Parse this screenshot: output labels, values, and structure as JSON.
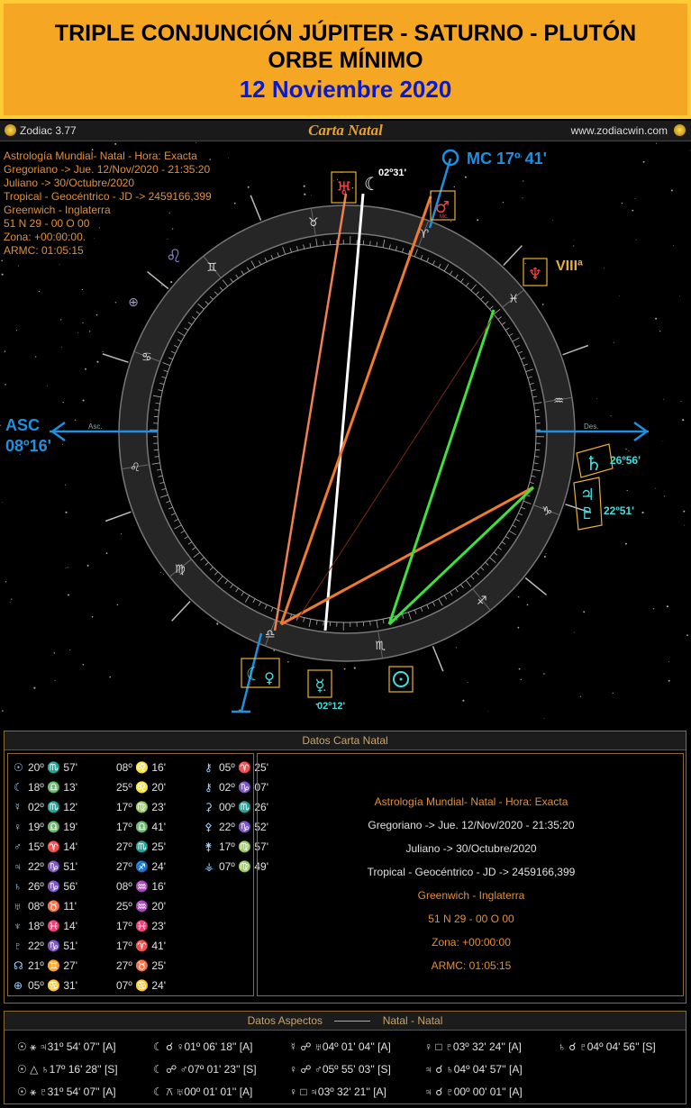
{
  "banner": {
    "line1": "TRIPLE CONJUNCIÓN JÚPITER - SATURNO - PLUTÓN",
    "line2": "ORBE MÍNIMO",
    "line3": "12 Noviembre 2020"
  },
  "window": {
    "app_name": "Zodiac 3.77",
    "title": "Carta Natal",
    "url": "www.zodiacwin.com"
  },
  "chart_info": [
    "Astrología Mundial- Natal - Hora: Exacta",
    "Gregoriano -> Jue. 12/Nov/2020 - 21:35:20",
    "Juliano -> 30/Octubre/2020",
    "Tropical - Geocéntrico - JD -> 2459166,399",
    "Greenwich - Inglaterra",
    "51 N 29 - 00 O 00",
    "Zona: +00:00:00.",
    "ARMC: 01:05:15"
  ],
  "wheel_labels": {
    "mc": "MC 17º 41'",
    "asc_1": "ASC",
    "asc_2": "08º16'",
    "asc_small": "Asc.",
    "des_small": "Des.",
    "house8": "VIIIª",
    "mc_small": "Mc.",
    "moon_deg": "02º31'",
    "saturn_deg": "26º56'",
    "jup_plu_deg": "22º51'",
    "mercury_deg": "02º12'"
  },
  "colors": {
    "banner_bg": "#f5a623",
    "banner_blue": "#0a1ac8",
    "ring": "#2b2b2b",
    "asc_mc": "#1e90e0",
    "orange": "#f07a30",
    "green": "#3ee03e",
    "highlight": "#e8b030"
  },
  "datos_carta": {
    "header": "Datos Carta Natal",
    "rows": [
      {
        "g1": "☉",
        "p1": "20º ♏ 57'",
        "g2": "",
        "p2": "08º ♌ 16'",
        "g3": "⚷",
        "p3": "05º ♈ 25'"
      },
      {
        "g1": "☾",
        "p1": "18º ♎ 13'",
        "g2": "",
        "p2": "25º ♌ 20'",
        "g3": "⚷",
        "p3": "02º ♑ 07'"
      },
      {
        "g1": "☿",
        "p1": "02º ♏ 12'",
        "g2": "",
        "p2": "17º ♍ 23'",
        "g3": "⚳",
        "p3": "00º ♏ 26'"
      },
      {
        "g1": "♀",
        "p1": "19º ♎ 19'",
        "g2": "",
        "p2": "17º ♎ 41'",
        "g3": "⚴",
        "p3": "22º ♑ 52'"
      },
      {
        "g1": "♂",
        "p1": "15º ♈ 14'",
        "g2": "",
        "p2": "27º ♏ 25'",
        "g3": "⚵",
        "p3": "17º ♍ 57'"
      },
      {
        "g1": "♃",
        "p1": "22º ♑ 51'",
        "g2": "",
        "p2": "27º ♐ 24'",
        "g3": "⚶",
        "p3": "07º ♍ 49'"
      },
      {
        "g1": "♄",
        "p1": "26º ♑ 56'",
        "g2": "",
        "p2": "08º ♒ 16'",
        "g3": "",
        "p3": ""
      },
      {
        "g1": "♅",
        "p1": "08º ♉ 11'",
        "g2": "",
        "p2": "25º ♒ 20'",
        "g3": "",
        "p3": ""
      },
      {
        "g1": "♆",
        "p1": "18º ♓ 14'",
        "g2": "",
        "p2": "17º ♓ 23'",
        "g3": "",
        "p3": ""
      },
      {
        "g1": "♇",
        "p1": "22º ♑ 51'",
        "g2": "",
        "p2": "17º ♈ 41'",
        "g3": "",
        "p3": ""
      },
      {
        "g1": "☊",
        "p1": "21º ♊ 27'",
        "g2": "",
        "p2": "27º ♉ 25'",
        "g3": "",
        "p3": ""
      },
      {
        "g1": "⊕",
        "p1": "05º ♋ 31'",
        "g2": "",
        "p2": "07º ♋ 24'",
        "g3": "",
        "p3": ""
      }
    ],
    "summary": [
      "Astrología Mundial- Natal - Hora: Exacta",
      "Gregoriano -> Jue. 12/Nov/2020 - 21:35:20",
      "Juliano -> 30/Octubre/2020",
      "Tropical - Geocéntrico - JD -> 2459166,399",
      "Greenwich - Inglaterra",
      "51 N 29 - 00 O 00",
      "Zona: +00:00:00",
      "ARMC: 01:05:15"
    ]
  },
  "datos_aspectos": {
    "header_left": "Datos Aspectos",
    "header_right": "Natal - Natal",
    "rows": [
      [
        "☉ ⚹ ♃31º 54' 07'' [A]",
        "☾ ☌ ♀01º 06' 18'' [A]",
        "☿ ☍ ♅04º 01' 04'' [A]",
        "♀ □ ♇03º 32' 24'' [A]",
        "♄ ☌ ♇04º 04' 56'' [S]"
      ],
      [
        "☉ △ ♄17º 16' 28'' [S]",
        "☾ ☍ ♂07º 01' 23'' [S]",
        "♀ ☍ ♂05º 55' 03'' [S]",
        "♃ ☌ ♄04º 04' 57'' [A]",
        ""
      ],
      [
        "☉ ⚹ ♇31º 54' 07'' [A]",
        "☾ ⚻ ♅00º 01' 01'' [A]",
        "♀ □ ♃03º 32' 21'' [A]",
        "♃ ☌ ♇00º 00' 01'' [A]",
        ""
      ]
    ]
  }
}
